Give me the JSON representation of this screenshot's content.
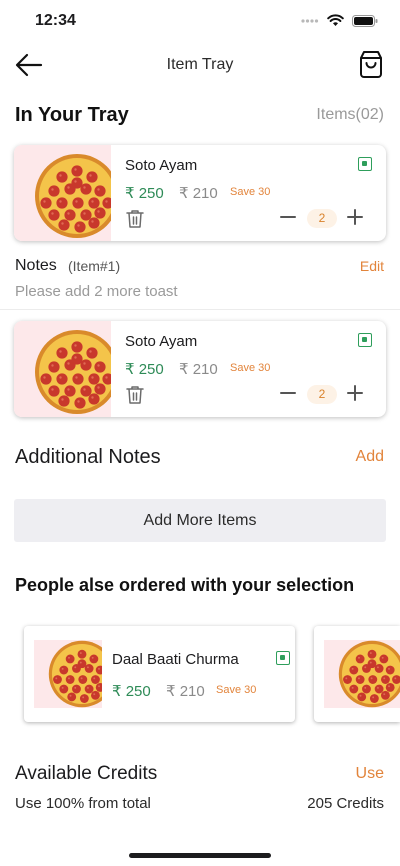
{
  "status_bar": {
    "time": "12:34"
  },
  "nav": {
    "title": "Item Tray"
  },
  "tray": {
    "title": "In Your Tray",
    "count": "Items(02)"
  },
  "tray_items": [
    {
      "name": "Soto Ayam",
      "price": "₹ 250",
      "old_price": "₹ 210",
      "save": "Save 30",
      "quantity": "2"
    },
    {
      "name": "Soto Ayam",
      "price": "₹ 250",
      "old_price": "₹ 210",
      "save": "Save 30",
      "quantity": "2"
    }
  ],
  "notes": {
    "label": "Notes",
    "item_ref": "(Item#1)",
    "edit": "Edit",
    "text": "Please add 2 more toast"
  },
  "additional_notes": {
    "title": "Additional Notes",
    "action": "Add"
  },
  "add_more": {
    "label": "Add More Items"
  },
  "suggestions": {
    "title": "People alse ordered with your selection",
    "items": [
      {
        "name": "Daal Baati Churma",
        "price": "₹ 250",
        "old_price": "₹ 210",
        "save": "Save 30"
      }
    ]
  },
  "credits": {
    "title": "Available Credits",
    "action": "Use",
    "subtitle": "Use 100% from total",
    "value": "205 Credits"
  },
  "colors": {
    "accent": "#e2843b",
    "price_green": "#2e8b57",
    "veg_green": "#2e9e5b",
    "image_bg": "#fde8ea"
  },
  "icons": [
    "back-arrow-icon",
    "shopping-bag-icon",
    "trash-icon",
    "minus-icon",
    "plus-icon",
    "veg-indicator-icon",
    "pizza-image"
  ]
}
